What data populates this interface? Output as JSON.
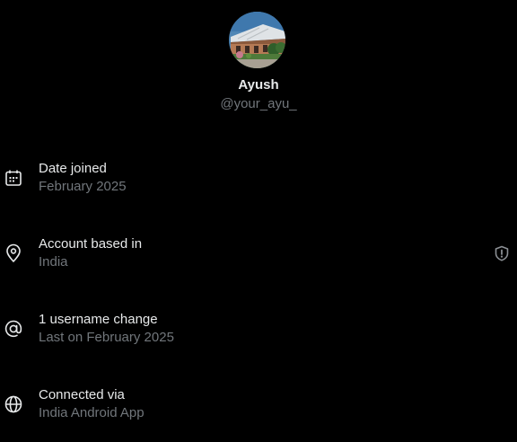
{
  "profile": {
    "display_name": "Ayush",
    "handle": "@your_ayu_"
  },
  "rows": [
    {
      "icon": "calendar-icon",
      "title": "Date joined",
      "subtitle": "February 2025"
    },
    {
      "icon": "location-pin-icon",
      "title": "Account based in",
      "subtitle": "India",
      "action_icon": "shield-icon"
    },
    {
      "icon": "at-sign-icon",
      "title": "1 username change",
      "subtitle": "Last on February 2025"
    },
    {
      "icon": "globe-icon",
      "title": "Connected via",
      "subtitle": "India Android App"
    }
  ],
  "colors": {
    "background": "#000000",
    "primary_text": "#e7e9ea",
    "secondary_text": "#71767b"
  }
}
